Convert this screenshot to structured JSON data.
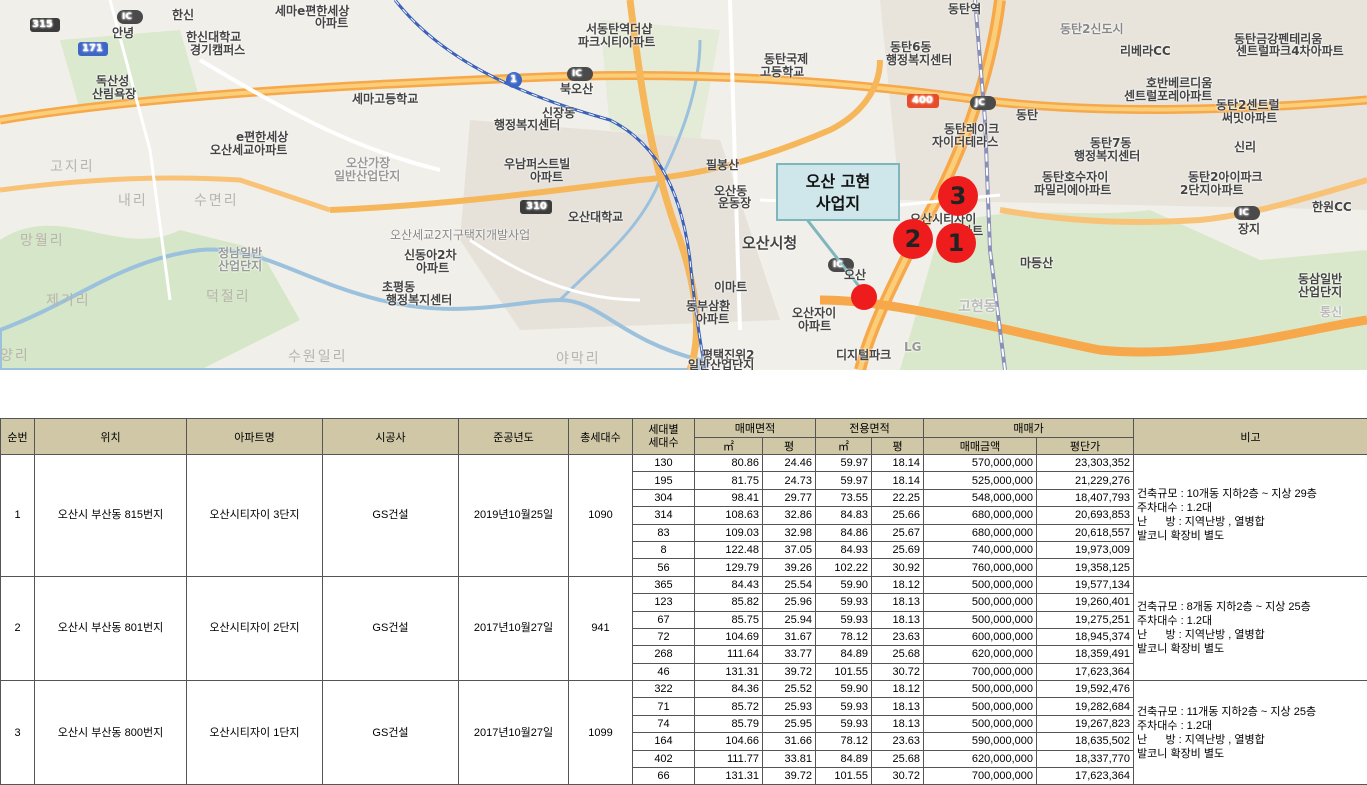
{
  "map": {
    "callout": {
      "line1": "오산 고현",
      "line2": "사업지"
    },
    "markers": [
      "1",
      "2",
      "3"
    ],
    "road_shields": [
      "315",
      "171",
      "1",
      "400",
      "310",
      "IC",
      "JC"
    ],
    "labels": [
      "한신",
      "세마e편한세상",
      "아파트",
      "안녕",
      "한신대학교",
      "경기캠퍼스",
      "서동탄역더샵",
      "파크시티아파트",
      "동탄국제",
      "고등학교",
      "동탄6동",
      "행정복지센터",
      "동탄역",
      "동탄2신도시",
      "리베라CC",
      "동탄금강펜테리움",
      "센트럴파크4차아파트",
      "독산성",
      "산림욕장",
      "북오산",
      "세마고등학교",
      "신장동",
      "행정복지센터",
      "호반베르디움",
      "센트럴포레아파트",
      "동탄2센트럴",
      "써밋아파트",
      "e편한세상",
      "오산세교아파트",
      "오산가장",
      "일반산업단지",
      "동탄레이크",
      "자이더테라스",
      "동탄7동",
      "행정복지센터",
      "신리",
      "우남퍼스트빌",
      "아파트",
      "필봉산",
      "오산동",
      "운동장",
      "동탄호수자이",
      "파밀리에아파트",
      "동탄2아이파크",
      "2단지아파트",
      "오산대학교",
      "한원CC",
      "오산세교2지구택지개발사업",
      "장지",
      "신동아2차",
      "아파트",
      "오산시청",
      "오산시티자이",
      "아파트",
      "정남일반",
      "산업단지",
      "이마트",
      "마등산",
      "초평동",
      "행정복지센터",
      "동부삼환",
      "아파트",
      "오산자이",
      "아파트",
      "고현동",
      "동삼일반",
      "산업단지",
      "평택진위2",
      "일반산업단지",
      "LG",
      "디지털파크",
      "오산",
      "동탄",
      "통신"
    ],
    "districts": [
      "고지리",
      "내리",
      "수면리",
      "망월리",
      "제기리",
      "덕절리",
      "수원일리",
      "야막리",
      "양리"
    ]
  },
  "table": {
    "headers": {
      "no": "순번",
      "location": "위치",
      "apt_name": "아파트명",
      "builder": "시공사",
      "completed": "준공년도",
      "total_units": "총세대수",
      "units_by_type": "세대별\n세대수",
      "sale_area": "매매면적",
      "exclusive_area": "전용면적",
      "price": "매매가",
      "remarks": "비고",
      "sqm": "㎡",
      "pyeong": "평",
      "sale_amount": "매매금액",
      "price_per_pyeong": "평단가"
    },
    "groups": [
      {
        "no": "1",
        "location": "오산시 부산동 815번지",
        "apt_name": "오산시티자이 3단지",
        "builder": "GS건설",
        "completed": "2019년10월25일",
        "total_units": "1090",
        "remarks": [
          "건축규모 : 10개동 지하2층 ~ 지상 29층",
          "주차대수 : 1.2대",
          "난      방 : 지역난방 , 열병합",
          "발코니 확장비 별도"
        ],
        "rows": [
          [
            "130",
            "80.86",
            "24.46",
            "59.97",
            "18.14",
            "570,000,000",
            "23,303,352"
          ],
          [
            "195",
            "81.75",
            "24.73",
            "59.97",
            "18.14",
            "525,000,000",
            "21,229,276"
          ],
          [
            "304",
            "98.41",
            "29.77",
            "73.55",
            "22.25",
            "548,000,000",
            "18,407,793"
          ],
          [
            "314",
            "108.63",
            "32.86",
            "84.83",
            "25.66",
            "680,000,000",
            "20,693,853"
          ],
          [
            "83",
            "109.03",
            "32.98",
            "84.86",
            "25.67",
            "680,000,000",
            "20,618,557"
          ],
          [
            "8",
            "122.48",
            "37.05",
            "84.93",
            "25.69",
            "740,000,000",
            "19,973,009"
          ],
          [
            "56",
            "129.79",
            "39.26",
            "102.22",
            "30.92",
            "760,000,000",
            "19,358,125"
          ]
        ]
      },
      {
        "no": "2",
        "location": "오산시 부산동 801번지",
        "apt_name": "오산시티자이 2단지",
        "builder": "GS건설",
        "completed": "2017년10월27일",
        "total_units": "941",
        "remarks": [
          "건축규모 : 8개동 지하2층 ~ 지상 25층",
          "주차대수 : 1.2대",
          "난      방 : 지역난방 , 열병합",
          "발코니 확장비 별도"
        ],
        "rows": [
          [
            "365",
            "84.43",
            "25.54",
            "59.90",
            "18.12",
            "500,000,000",
            "19,577,134"
          ],
          [
            "123",
            "85.82",
            "25.96",
            "59.93",
            "18.13",
            "500,000,000",
            "19,260,401"
          ],
          [
            "67",
            "85.75",
            "25.94",
            "59.93",
            "18.13",
            "500,000,000",
            "19,275,251"
          ],
          [
            "72",
            "104.69",
            "31.67",
            "78.12",
            "23.63",
            "600,000,000",
            "18,945,374"
          ],
          [
            "268",
            "111.64",
            "33.77",
            "84.89",
            "25.68",
            "620,000,000",
            "18,359,491"
          ],
          [
            "46",
            "131.31",
            "39.72",
            "101.55",
            "30.72",
            "700,000,000",
            "17,623,364"
          ]
        ]
      },
      {
        "no": "3",
        "location": "오산시 부산동 800번지",
        "apt_name": "오산시티자이 1단지",
        "builder": "GS건설",
        "completed": "2017년10월27일",
        "total_units": "1099",
        "remarks": [
          "건축규모 : 11개동 지하2층 ~ 지상 25층",
          "주차대수 : 1.2대",
          "난      방 : 지역난방 , 열병합",
          "발코니 확장비 별도"
        ],
        "rows": [
          [
            "322",
            "84.36",
            "25.52",
            "59.90",
            "18.12",
            "500,000,000",
            "19,592,476"
          ],
          [
            "71",
            "85.72",
            "25.93",
            "59.93",
            "18.13",
            "500,000,000",
            "19,282,684"
          ],
          [
            "74",
            "85.79",
            "25.95",
            "59.93",
            "18.13",
            "500,000,000",
            "19,267,823"
          ],
          [
            "164",
            "104.66",
            "31.66",
            "78.12",
            "23.63",
            "590,000,000",
            "18,635,502"
          ],
          [
            "402",
            "111.77",
            "33.81",
            "84.89",
            "25.68",
            "620,000,000",
            "18,337,770"
          ],
          [
            "66",
            "131.31",
            "39.72",
            "101.55",
            "30.72",
            "700,000,000",
            "17,623,364"
          ]
        ]
      }
    ]
  }
}
